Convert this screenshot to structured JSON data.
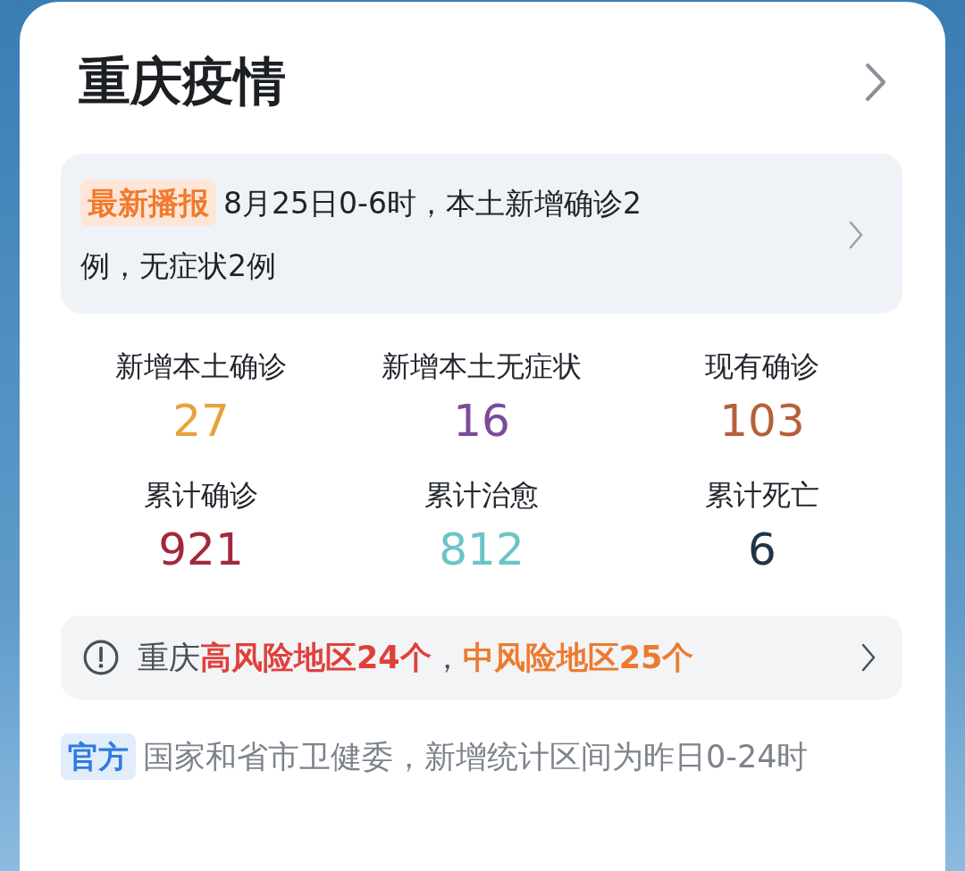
{
  "title": "重庆疫情",
  "news": {
    "tag": "最新播报",
    "text": "8月25日0-6时，本土新增确诊2例，无症状2例"
  },
  "stats": [
    {
      "label": "新增本土确诊",
      "value": "27",
      "color": "#e8a23c"
    },
    {
      "label": "新增本土无症状",
      "value": "16",
      "color": "#7a4b9a"
    },
    {
      "label": "现有确诊",
      "value": "103",
      "color": "#b5603c"
    },
    {
      "label": "累计确诊",
      "value": "921",
      "color": "#a3283a"
    },
    {
      "label": "累计治愈",
      "value": "812",
      "color": "#6cc4c6"
    },
    {
      "label": "累计死亡",
      "value": "6",
      "color": "#1f3547"
    }
  ],
  "risk": {
    "region": "重庆",
    "high": "高风险地区24个",
    "separator": "，",
    "medium": "中风险地区25个"
  },
  "source": {
    "tag": "官方",
    "text": "国家和省市卫健委，新增统计区间为昨日0-24时"
  }
}
